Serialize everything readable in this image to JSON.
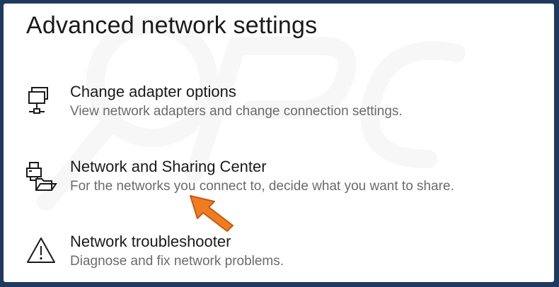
{
  "page": {
    "title": "Advanced network settings"
  },
  "items": [
    {
      "label": "Change adapter options",
      "description": "View network adapters and change connection settings.",
      "icon": "network-adapter-icon"
    },
    {
      "label": "Network and Sharing Center",
      "description": "For the networks you connect to, decide what you want to share.",
      "icon": "sharing-center-icon"
    },
    {
      "label": "Network troubleshooter",
      "description": "Diagnose and fix network problems.",
      "icon": "warning-icon"
    }
  ],
  "annotation": {
    "icon": "orange-arrow-pointer-icon",
    "color": "#f07c22"
  },
  "colors": {
    "frame": "#1f3a5f",
    "background": "#ffffff",
    "text_primary": "#1a1a1a",
    "text_secondary": "#6b6b6b"
  }
}
